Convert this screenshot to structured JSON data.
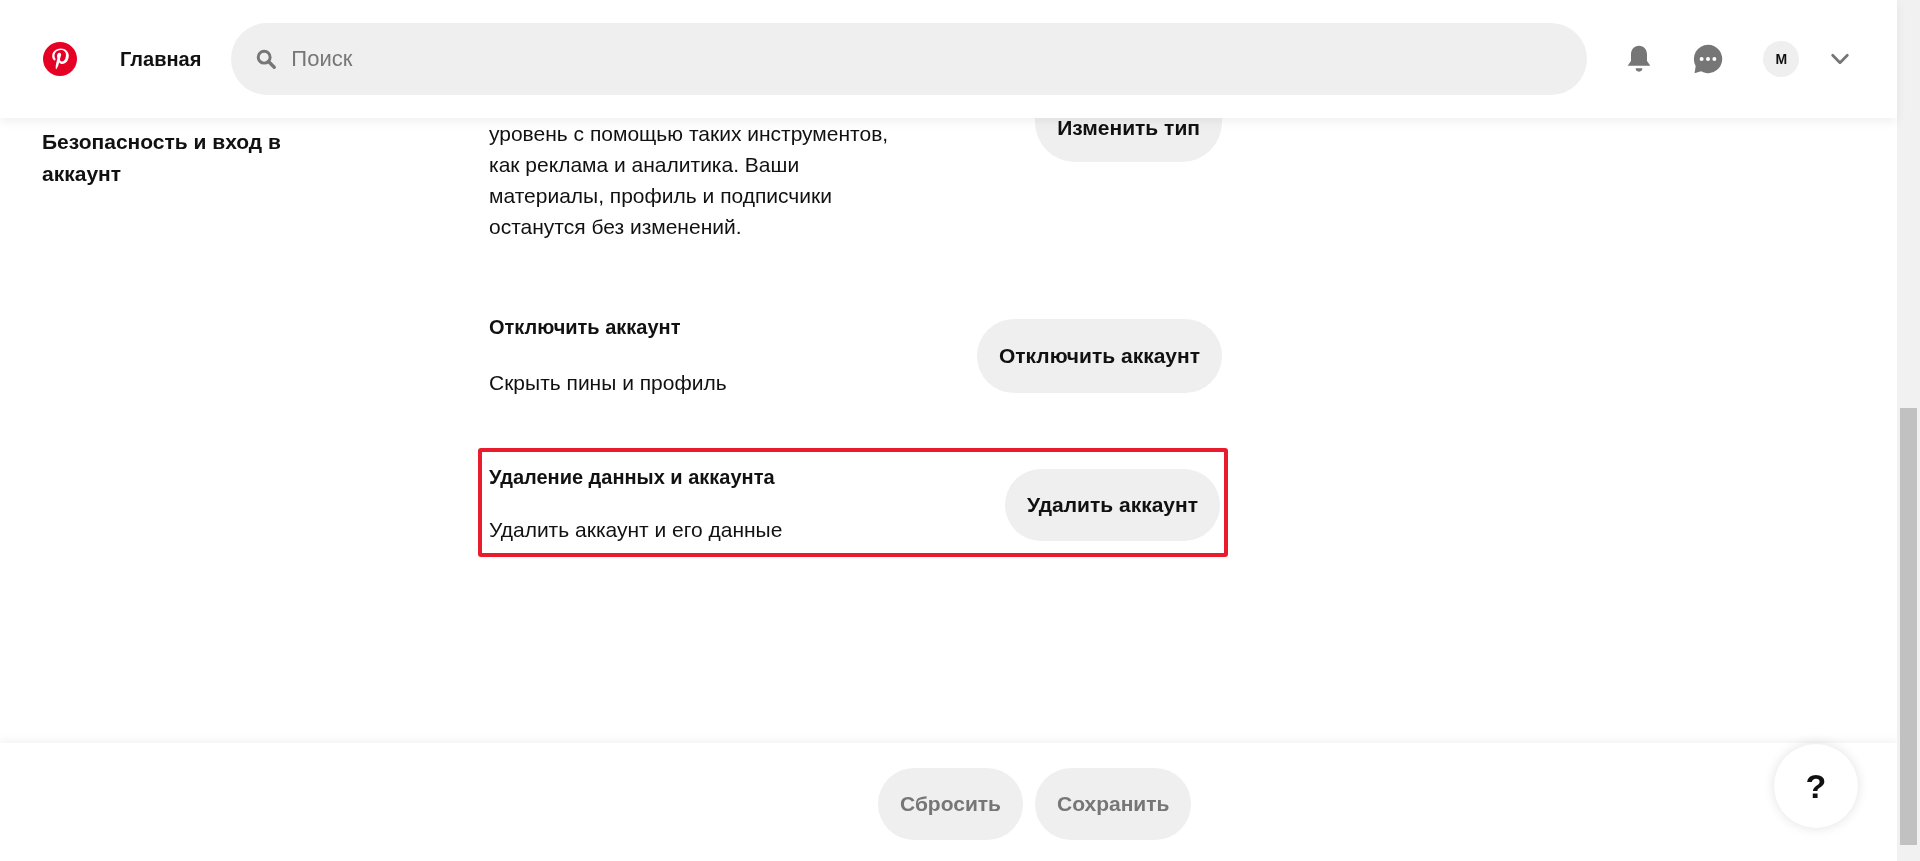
{
  "header": {
    "home_link": "Главная",
    "search": {
      "placeholder": "Поиск"
    },
    "avatar_initial": "M"
  },
  "sidebar": {
    "items": [
      {
        "label": "Безопасность и вход в аккаунт"
      }
    ]
  },
  "sections": [
    {
      "description": "уровень с помощью таких инструментов, как реклама и аналитика. Ваши материалы, профиль и подписчики останутся без изменений.",
      "button": "Изменить тип",
      "highlighted": false
    },
    {
      "title": "Отключить аккаунт",
      "description": "Скрыть пины и профиль",
      "button": "Отключить аккаунт",
      "highlighted": false
    },
    {
      "title": "Удаление данных и аккаунта",
      "description": "Удалить аккаунт и его данные",
      "button": "Удалить аккаунт",
      "highlighted": true
    }
  ],
  "footer": {
    "buttons": [
      {
        "label": "Сбросить",
        "disabled": true
      },
      {
        "label": "Сохранить",
        "disabled": true
      }
    ],
    "help_button": "?"
  }
}
